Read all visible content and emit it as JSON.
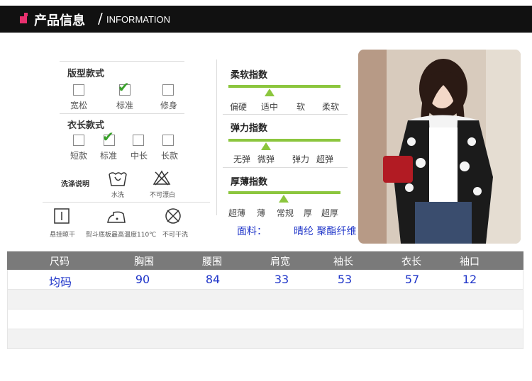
{
  "header": {
    "title_cn": "产品信息",
    "slash": "/",
    "title_en": "INFORMATION"
  },
  "fit": {
    "title": "版型款式",
    "options": [
      {
        "label": "宽松",
        "checked": false
      },
      {
        "label": "标准",
        "checked": true
      },
      {
        "label": "修身",
        "checked": false
      }
    ]
  },
  "length": {
    "title": "衣长款式",
    "options": [
      {
        "label": "短款",
        "checked": false
      },
      {
        "label": "标准",
        "checked": true
      },
      {
        "label": "中长",
        "checked": false
      },
      {
        "label": "长款",
        "checked": false
      }
    ]
  },
  "washing": {
    "title": "洗涤说明",
    "items": [
      {
        "icon": "hand-wash-icon",
        "label": "水洗"
      },
      {
        "icon": "no-bleach-icon",
        "label": "不可漂白"
      },
      {
        "icon": "hang-dry-icon",
        "label": "悬挂晾干"
      },
      {
        "icon": "iron-icon",
        "label": "熨斗底板最高温度110℃"
      },
      {
        "icon": "no-dry-clean-icon",
        "label": "不可干洗"
      }
    ]
  },
  "softness": {
    "title": "柔软指数",
    "labels": [
      "偏硬",
      "适中",
      "软",
      "柔软"
    ],
    "selected": "适中"
  },
  "elasticity": {
    "title": "弹力指数",
    "labels": [
      "无弹",
      "微弹",
      "弹力",
      "超弹"
    ],
    "selected": "微弹"
  },
  "thickness": {
    "title": "厚薄指数",
    "labels": [
      "超薄",
      "薄",
      "常规",
      "厚",
      "超厚"
    ],
    "selected": "常规"
  },
  "fabric": {
    "label": "面料：",
    "value": "晴纶 聚酯纤维"
  },
  "size_table": {
    "headers": [
      "尺码",
      "胸围",
      "腰围",
      "肩宽",
      "袖长",
      "衣长",
      "袖口"
    ],
    "rows": [
      [
        "均码",
        "90",
        "84",
        "33",
        "53",
        "57",
        "12"
      ]
    ]
  },
  "colors": {
    "accent": "#e8306e",
    "index_bar": "#8cc63e",
    "check": "#3aa12b",
    "value_text": "#1f35c9",
    "table_header": "#7a7a7a"
  }
}
